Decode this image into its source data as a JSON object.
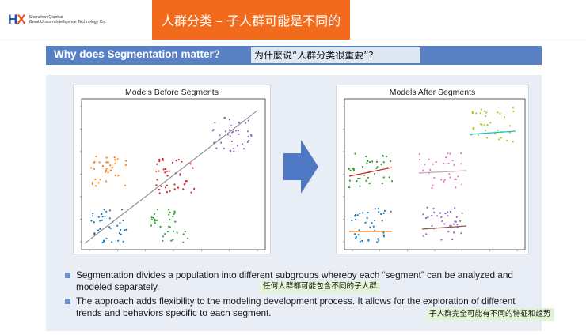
{
  "header": {
    "logo_mark_left": "H",
    "logo_mark_right": "X",
    "company_line1": "Shenzhen Qianhai",
    "company_line2": "Great Unicorn Intelligence Technology Co.",
    "title": "人群分类 – 子人群可能是不同的"
  },
  "section": {
    "title": "Why does Segmentation matter?",
    "title_cn": "为什麼说“人群分类很重要”?"
  },
  "plots": {
    "before": {
      "title": "Models Before Segments"
    },
    "after": {
      "title": "Models After Segments"
    }
  },
  "colors": {
    "blue": "#1f77b4",
    "orange": "#ff7f0e",
    "green": "#2ca02c",
    "red": "#d62728",
    "purple": "#9467bd",
    "pink": "#e377c2",
    "olive": "#bcbd22",
    "teal": "#17becf",
    "brown": "#8c564b",
    "accent_orange": "#f26a1b",
    "bar_blue": "#5a80c4"
  },
  "bullets": [
    {
      "text": "Segmentation divides a population into different subgroups whereby each “segment” can be analyzed and modeled separately."
    },
    {
      "text": "The approach adds flexibility to the modeling development process. It allows for the exploration of different trends and behaviors specific to each segment."
    }
  ],
  "notes": {
    "note1": "任何人群都可能包含不同的子人群",
    "note2": "子人群完全可能有不同的特征和趋势"
  }
}
